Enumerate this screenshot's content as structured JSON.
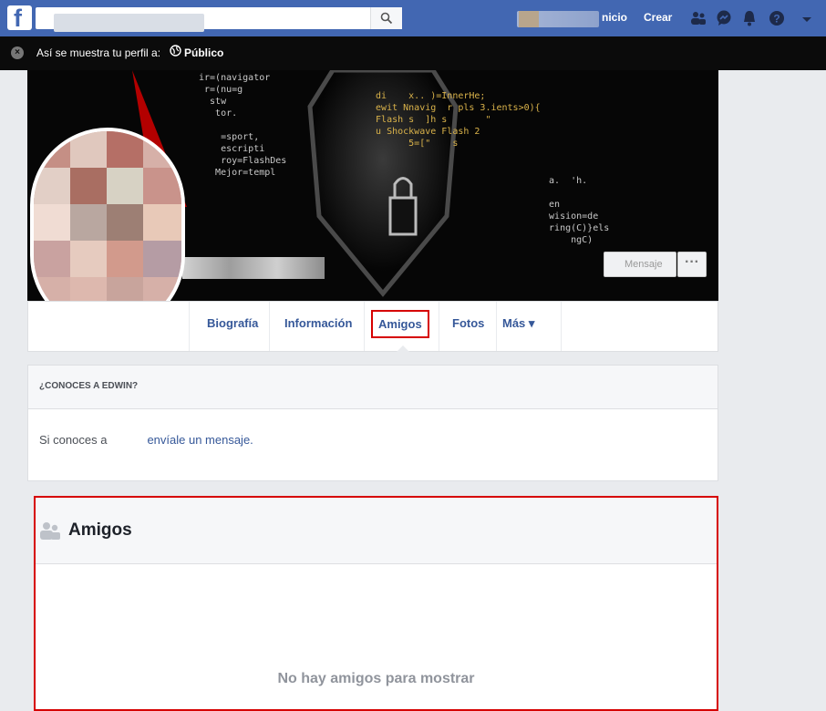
{
  "topbar": {
    "logo": "f",
    "search": {
      "placeholder": "",
      "value": ""
    },
    "nav": {
      "home": "Inicio",
      "create": "Crear"
    },
    "icons": [
      "friends-icon",
      "messenger-icon",
      "notifications-icon",
      "help-icon",
      "dropdown-icon"
    ]
  },
  "preview_bar": {
    "close": "×",
    "text": "Así se muestra tu perfil a:",
    "audience": "Público"
  },
  "cover": {
    "message_button": "Mensaje",
    "more_button": "···"
  },
  "tabs": {
    "items": [
      "Biografía",
      "Información",
      "Amigos",
      "Fotos",
      "Más ▾"
    ],
    "active": "Amigos"
  },
  "know_card": {
    "title": "¿CONOCES A EDWIN?",
    "text_before": "Si conoces a",
    "link": "envíale un mensaje."
  },
  "friends_card": {
    "title": "Amigos",
    "empty": "No hay amigos para mostrar"
  },
  "colors": {
    "brand": "#4267b2",
    "highlight": "#d60000",
    "link": "#365899"
  }
}
